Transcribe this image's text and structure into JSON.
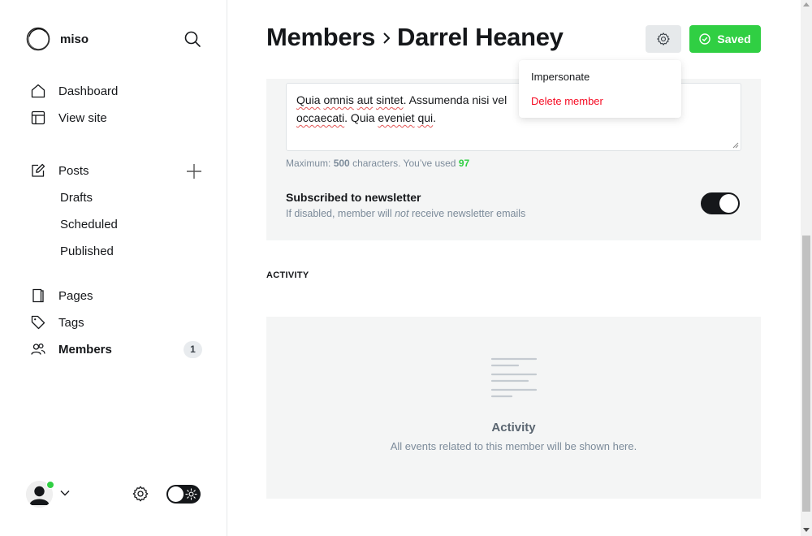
{
  "brand": {
    "name": "miso"
  },
  "nav": {
    "dashboard": "Dashboard",
    "view_site": "View site",
    "posts": "Posts",
    "drafts": "Drafts",
    "scheduled": "Scheduled",
    "published": "Published",
    "pages": "Pages",
    "tags": "Tags",
    "members": "Members",
    "members_count": "1"
  },
  "header": {
    "breadcrumb_parent": "Members",
    "breadcrumb_current": "Darrel Heaney",
    "saved_label": "Saved"
  },
  "dropdown": {
    "impersonate": "Impersonate",
    "delete_member": "Delete member"
  },
  "note": {
    "line1_a": "Quia",
    "line1_b": "omnis",
    "line1_c": "aut",
    "line1_d": "sint",
    "line1_e": "et",
    "line1_rest": ". Assumenda nisi vel",
    "line2_a": "occaecati",
    "line2_b": ". Quia",
    "line2_c": "eveniet",
    "line2_d": "qui",
    "line2_end": ".",
    "hint_prefix": "Maximum:",
    "hint_max": "500",
    "hint_mid": "characters. You’ve used",
    "hint_used": "97"
  },
  "newsletter": {
    "title": "Subscribed to newsletter",
    "desc_a": "If disabled, member will",
    "desc_em": "not",
    "desc_b": "receive newsletter emails",
    "enabled": true
  },
  "activity": {
    "section_label": "ACTIVITY",
    "empty_title": "Activity",
    "empty_desc": "All events related to this member will be shown here."
  },
  "colors": {
    "accent_green": "#30cf43",
    "danger_red": "#f50b23",
    "text_dark": "#15171a",
    "muted": "#7c8b9a"
  }
}
